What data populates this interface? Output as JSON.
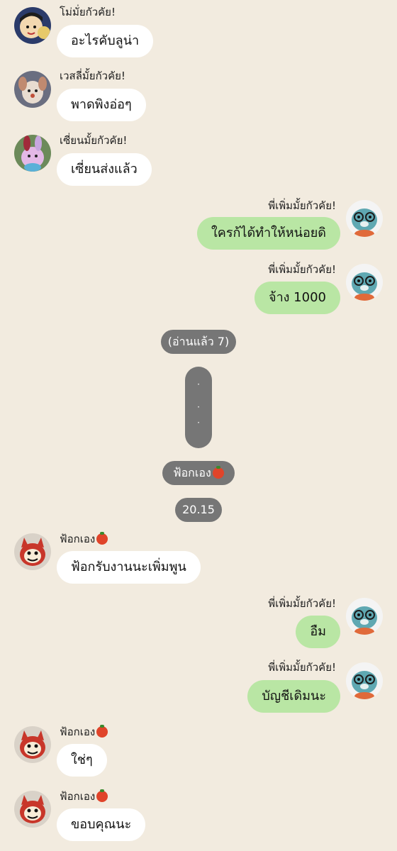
{
  "messages": [
    {
      "sender": "โม่มั่ยกัวคัย!",
      "text": "อะไรคับลูน่า",
      "side": "in",
      "avatar_icon": "boy-cartoon-avatar-icon"
    },
    {
      "sender": "เวสลี่มั้ยกัวคัย!",
      "text": "พาดพิงอ่อๆ",
      "side": "in",
      "avatar_icon": "dog-doll-avatar-icon"
    },
    {
      "sender": "เซี่ยนมั้ยกัวคัย!",
      "text": "เซี่ยนส่งแล้ว",
      "side": "in",
      "avatar_icon": "bunny-doll-avatar-icon"
    },
    {
      "sender": "พี่เพิ่มมั้ยกัวคัย!",
      "text": "ใครก้ได้ทำให้หน่อยดิ",
      "side": "out",
      "avatar_icon": "blue-cat-glasses-avatar-icon"
    },
    {
      "sender": "พี่เพิ่มมั้ยกัวคัย!",
      "text": "จ้าง 1000",
      "side": "out",
      "avatar_icon": "blue-cat-glasses-avatar-icon"
    },
    {
      "sender": "ฟ้อกเอง",
      "text": "ฟ้อกรับงานนะเพิ่มพูน",
      "side": "in",
      "avatar_icon": "red-cat-avatar-icon",
      "sender_emoji": "tomato-icon"
    },
    {
      "sender": "พี่เพิ่มมั้ยกัวคัย!",
      "text": "อืม",
      "side": "out",
      "avatar_icon": "blue-cat-glasses-avatar-icon"
    },
    {
      "sender": "พี่เพิ่มมั้ยกัวคัย!",
      "text": "บัญชีเดิมนะ",
      "side": "out",
      "avatar_icon": "blue-cat-glasses-avatar-icon"
    },
    {
      "sender": "ฟ้อกเอง",
      "text": "ใช่ๆ",
      "side": "in",
      "avatar_icon": "red-cat-avatar-icon",
      "sender_emoji": "tomato-icon"
    },
    {
      "sender": "ฟ้อกเอง",
      "text": "ขอบคุณนะ",
      "side": "in",
      "avatar_icon": "red-cat-avatar-icon",
      "sender_emoji": "tomato-icon"
    }
  ],
  "read_receipt": "(อ่านแล้ว 7)",
  "dots_indicator": [
    "·",
    "·",
    "·"
  ],
  "typing_label": "ฟ้อกเอง",
  "typing_label_emoji": "tomato-icon",
  "timestamp": "20.15",
  "colors": {
    "background": "#f2ebdf",
    "incoming_bubble": "#ffffff",
    "outgoing_bubble": "#b9e6a4",
    "system_pill": "#767676"
  }
}
